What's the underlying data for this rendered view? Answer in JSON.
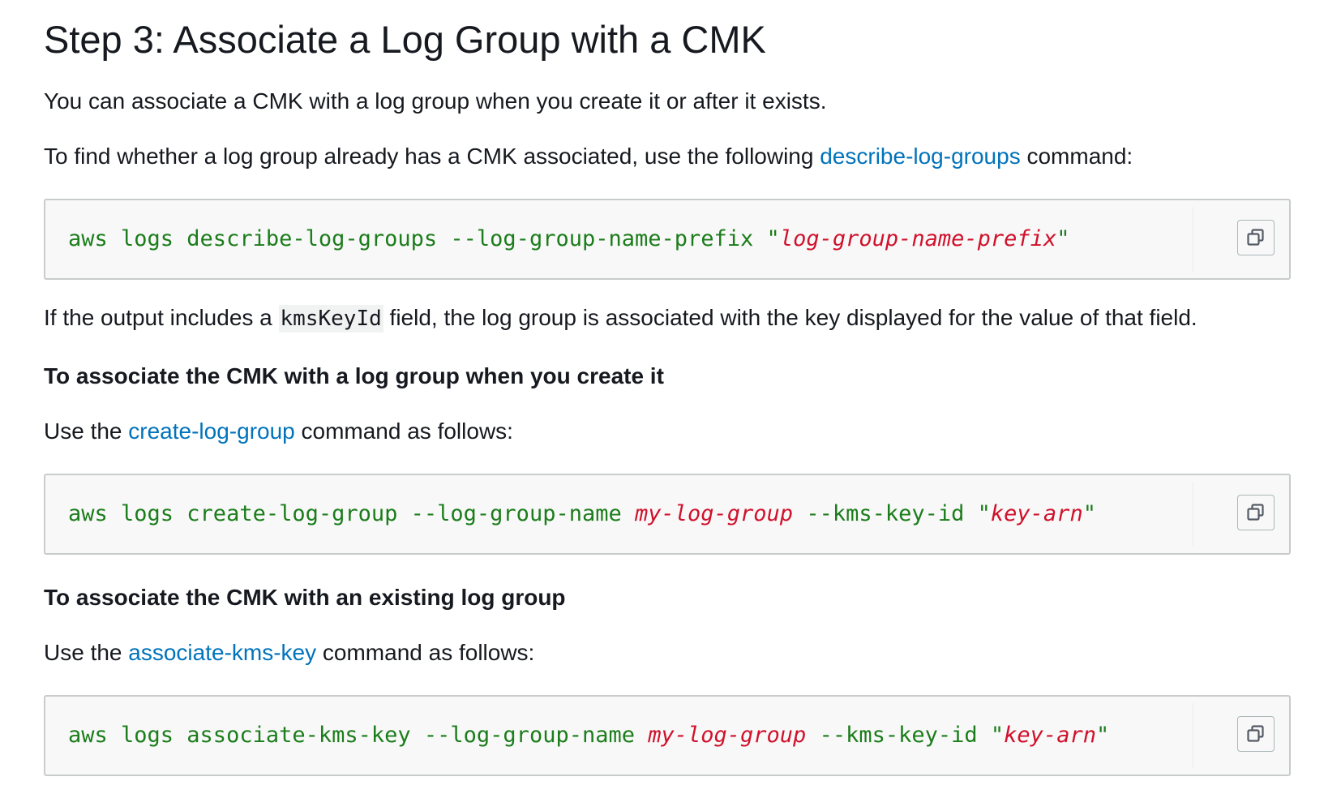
{
  "title": "Step 3: Associate a Log Group with a CMK",
  "intro": "You can associate a CMK with a log group when you create it or after it exists.",
  "find_para": {
    "before": "To find whether a log group already has a CMK associated, use the following ",
    "link": "describe-log-groups",
    "after": " command:"
  },
  "code1": {
    "command": "aws logs describe-log-groups --log-group-name-prefix ",
    "quote_open": "\"",
    "var": "log-group-name-prefix",
    "quote_close": "\""
  },
  "output_para": {
    "before": "If the output includes a ",
    "code": "kmsKeyId",
    "after": " field, the log group is associated with the key displayed for the value of that field."
  },
  "heading_create": "To associate the CMK with a log group when you create it",
  "create_para": {
    "before": "Use the ",
    "link": "create-log-group",
    "after": " command as follows:"
  },
  "code2": {
    "part1": "aws logs create-log-group --log-group-name ",
    "var1": "my-log-group",
    "part2": " --kms-key-id ",
    "quote_open": "\"",
    "var2": "key-arn",
    "quote_close": "\""
  },
  "heading_existing": "To associate the CMK with an existing log group",
  "assoc_para": {
    "before": "Use the ",
    "link": "associate-kms-key",
    "after": " command as follows:"
  },
  "code3": {
    "part1": "aws logs associate-kms-key --log-group-name ",
    "var1": "my-log-group",
    "part2": " --kms-key-id ",
    "quote_open": "\"",
    "var2": "key-arn",
    "quote_close": "\""
  },
  "colors": {
    "text": "#16191f",
    "link": "#0073bb",
    "code_text": "#1b7d1b",
    "code_var": "#d0112b",
    "code_bg": "#f8f8f8",
    "code_border": "#c9cccc"
  },
  "icons": {
    "copy": "copy-icon"
  }
}
